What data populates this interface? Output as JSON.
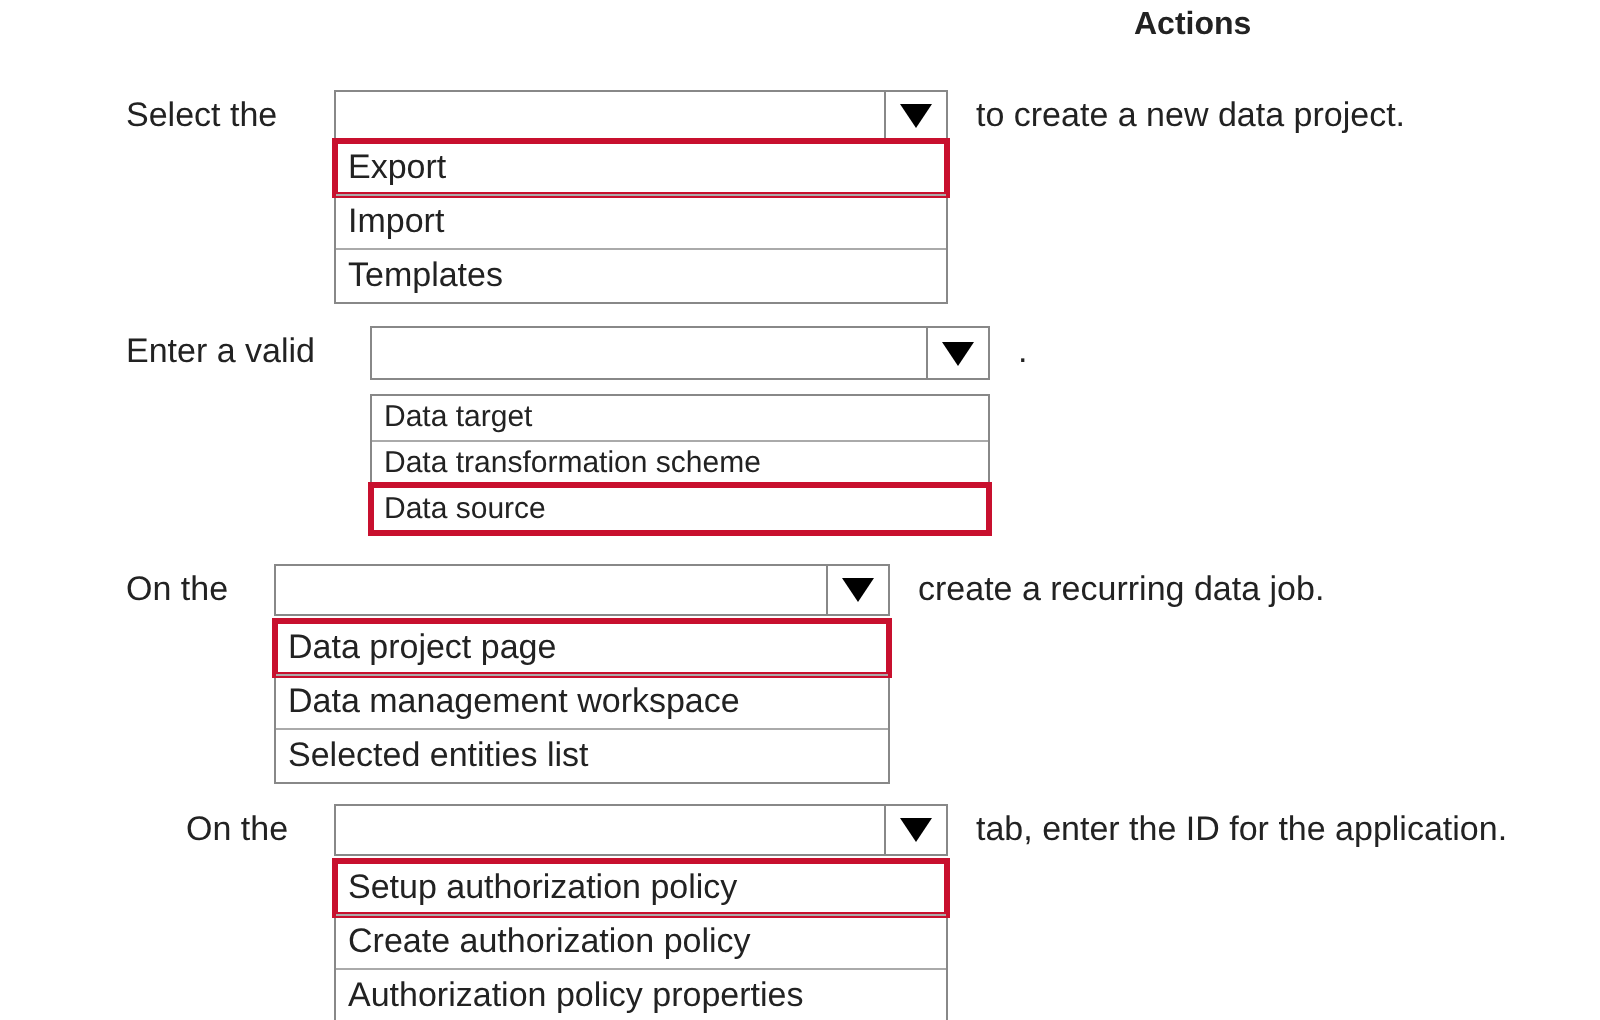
{
  "heading": "Actions",
  "questions": [
    {
      "prompt": "Select the",
      "suffix": "to create a new data project.",
      "options": [
        {
          "label": "Export",
          "selected": true
        },
        {
          "label": "Import",
          "selected": false
        },
        {
          "label": "Templates",
          "selected": false
        }
      ]
    },
    {
      "prompt": "Enter a valid",
      "suffix": ".",
      "options": [
        {
          "label": "Data target",
          "selected": false
        },
        {
          "label": "Data transformation scheme",
          "selected": false
        },
        {
          "label": "Data source",
          "selected": true
        }
      ]
    },
    {
      "prompt": "On the",
      "suffix": "create a recurring data job.",
      "options": [
        {
          "label": "Data project page",
          "selected": true
        },
        {
          "label": "Data management workspace",
          "selected": false
        },
        {
          "label": "Selected entities list",
          "selected": false
        }
      ]
    },
    {
      "prompt": "On the",
      "suffix": "tab, enter the ID for the application.",
      "options": [
        {
          "label": "Setup authorization policy",
          "selected": true
        },
        {
          "label": "Create authorization policy",
          "selected": false
        },
        {
          "label": "Authorization policy properties",
          "selected": false
        }
      ]
    }
  ]
}
